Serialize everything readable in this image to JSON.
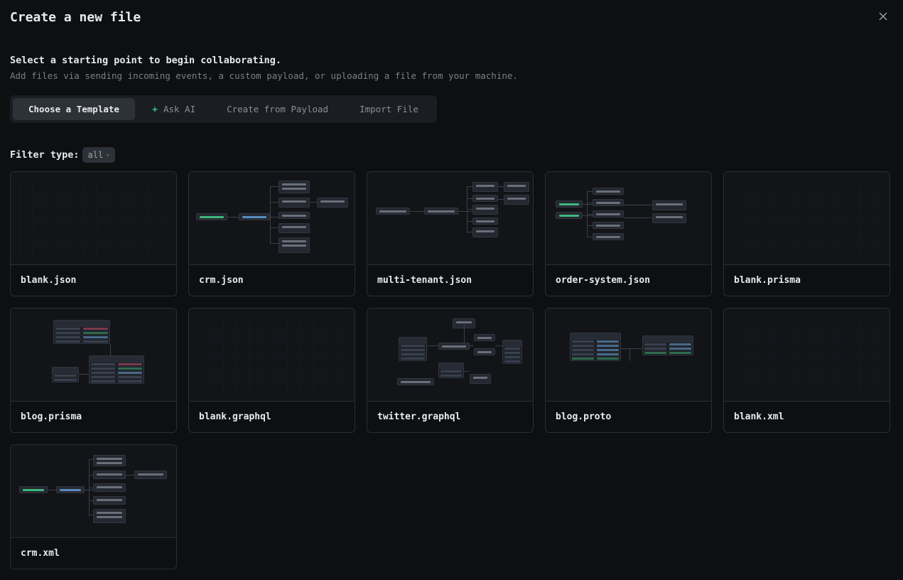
{
  "header": {
    "title": "Create a new file",
    "subtitle": "Select a starting point to begin collaborating.",
    "description": "Add files via sending incoming events, a custom payload, or uploading a file from your machine."
  },
  "tabs": [
    {
      "label": "Choose a Template",
      "active": true
    },
    {
      "label": "Ask AI",
      "active": false,
      "icon": "sparkle"
    },
    {
      "label": "Create from Payload",
      "active": false
    },
    {
      "label": "Import File",
      "active": false
    }
  ],
  "filter": {
    "label": "Filter type:",
    "value": "all"
  },
  "templates": [
    {
      "name": "blank.json",
      "preview": "grid"
    },
    {
      "name": "crm.json",
      "preview": "d1"
    },
    {
      "name": "multi-tenant.json",
      "preview": "d2"
    },
    {
      "name": "order-system.json",
      "preview": "d3"
    },
    {
      "name": "blank.prisma",
      "preview": "grid"
    },
    {
      "name": "blog.prisma",
      "preview": "t1"
    },
    {
      "name": "blank.graphql",
      "preview": "grid"
    },
    {
      "name": "twitter.graphql",
      "preview": "d4"
    },
    {
      "name": "blog.proto",
      "preview": "t2"
    },
    {
      "name": "blank.xml",
      "preview": "grid"
    },
    {
      "name": "crm.xml",
      "preview": "d5"
    }
  ]
}
